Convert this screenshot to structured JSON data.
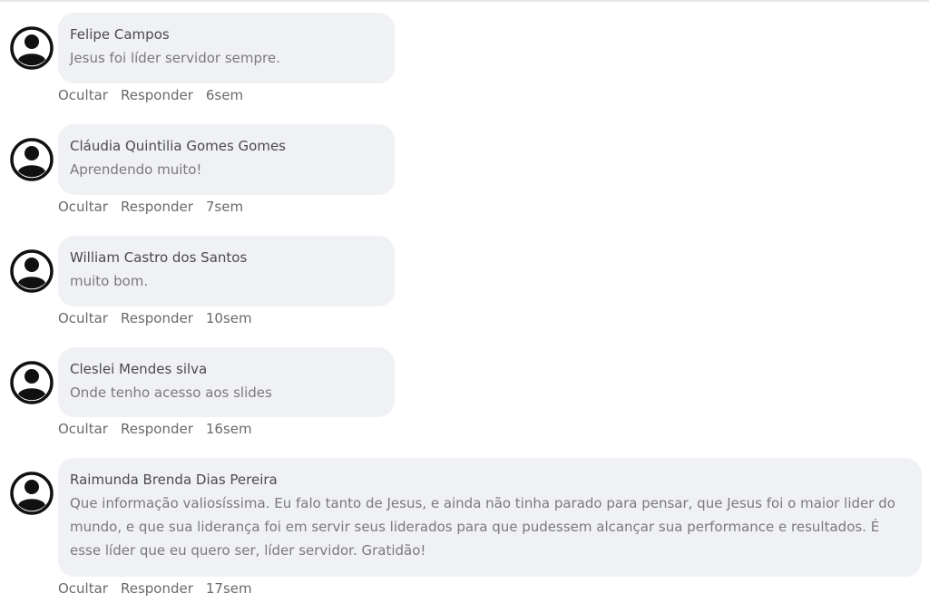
{
  "comments": [
    {
      "author": "Felipe Campos",
      "text": "Jesus foi líder servidor sempre.",
      "hide_label": "Ocultar",
      "reply_label": "Responder",
      "time": "6sem"
    },
    {
      "author": "Cláudia Quintilia Gomes Gomes",
      "text": "Aprendendo muito!",
      "hide_label": "Ocultar",
      "reply_label": "Responder",
      "time": "7sem"
    },
    {
      "author": "William Castro dos Santos",
      "text": "muito bom.",
      "hide_label": "Ocultar",
      "reply_label": "Responder",
      "time": "10sem"
    },
    {
      "author": "Cleslei Mendes silva",
      "text": "Onde tenho acesso aos slides",
      "hide_label": "Ocultar",
      "reply_label": "Responder",
      "time": "16sem"
    },
    {
      "author": "Raimunda Brenda Dias Pereira",
      "text": "Que informação valiosíssima. Eu falo tanto de Jesus, e ainda não tinha parado para pensar, que Jesus foi o maior lider do mundo, e que sua liderança foi em servir seus liderados para que pudessem alcançar sua performance e resultados. É esse líder que eu quero ser, líder servidor. Gratidão!",
      "hide_label": "Ocultar",
      "reply_label": "Responder",
      "time": "17sem"
    }
  ],
  "icons": {
    "avatar": "user-avatar-icon"
  }
}
